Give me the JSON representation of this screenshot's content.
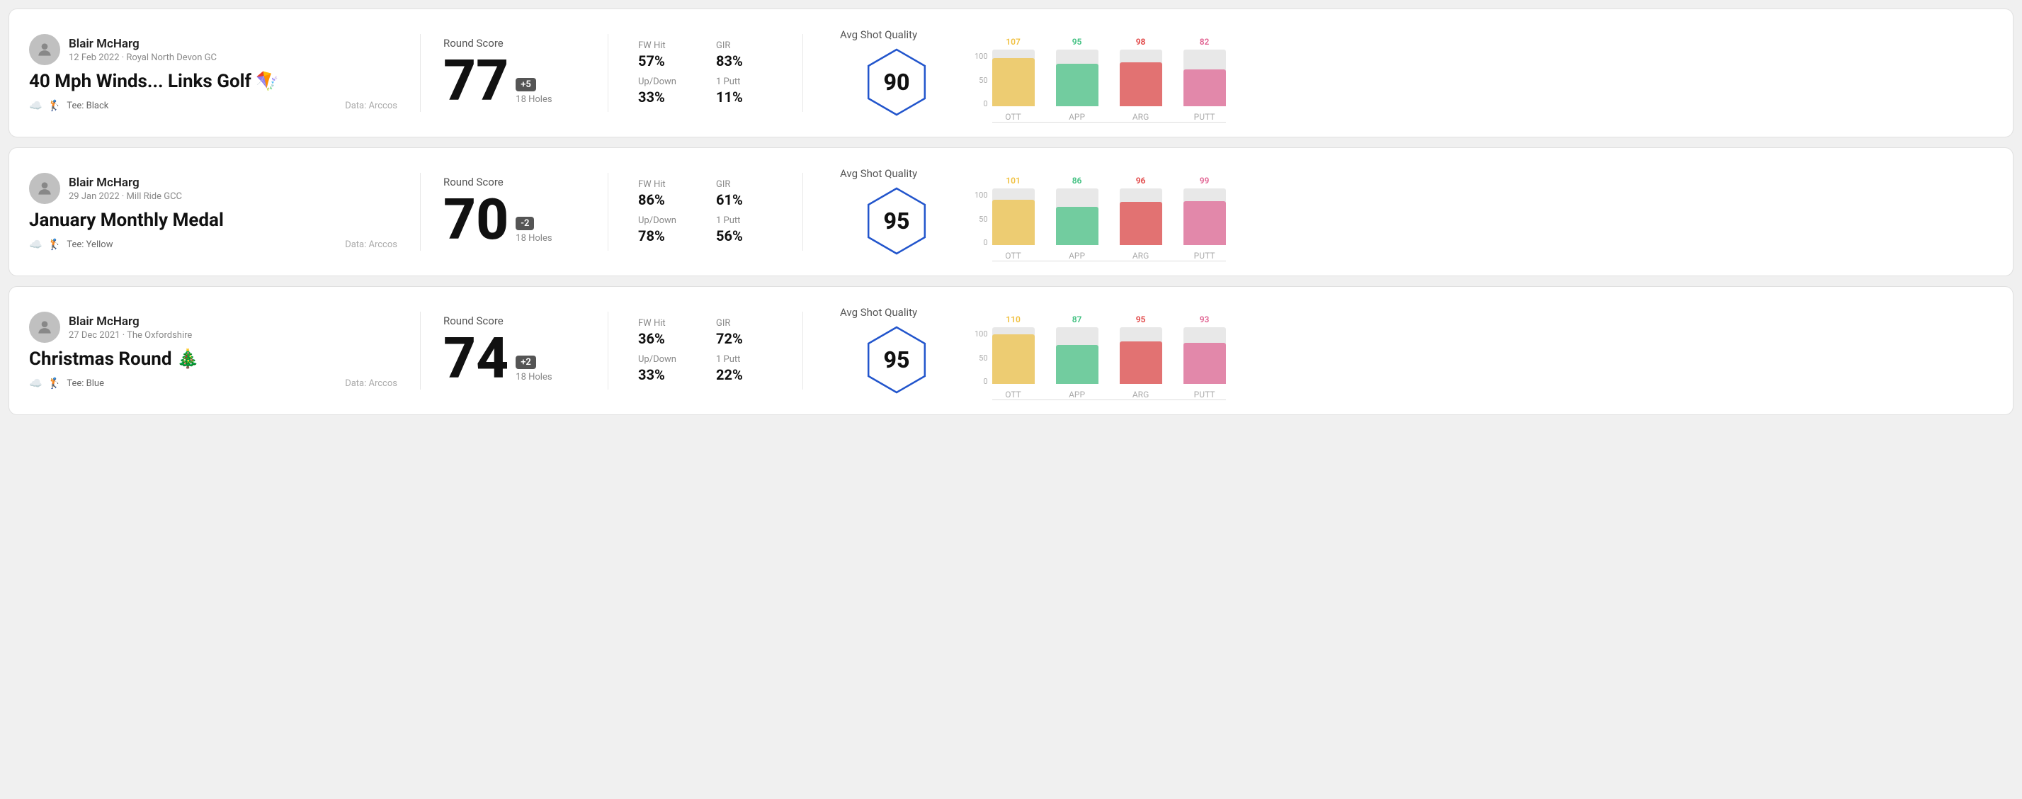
{
  "rounds": [
    {
      "id": "round1",
      "user": {
        "name": "Blair McHarg",
        "date_course": "12 Feb 2022 · Royal North Devon GC"
      },
      "title": "40 Mph Winds... Links Golf 🪁",
      "tee": "Black",
      "data_source": "Data: Arccos",
      "score": "77",
      "score_badge": "+5",
      "holes": "18 Holes",
      "fw_hit": "57%",
      "gir": "83%",
      "up_down": "33%",
      "one_putt": "11%",
      "shot_quality": "90",
      "chart": {
        "ott": {
          "value": 107,
          "color": "#f0c040",
          "pct": 85
        },
        "app": {
          "value": 95,
          "color": "#40c080",
          "pct": 75
        },
        "arg": {
          "value": 98,
          "color": "#e04040",
          "pct": 78
        },
        "putt": {
          "value": 82,
          "color": "#e06090",
          "pct": 65
        }
      }
    },
    {
      "id": "round2",
      "user": {
        "name": "Blair McHarg",
        "date_course": "29 Jan 2022 · Mill Ride GCC"
      },
      "title": "January Monthly Medal",
      "tee": "Yellow",
      "data_source": "Data: Arccos",
      "score": "70",
      "score_badge": "-2",
      "holes": "18 Holes",
      "fw_hit": "86%",
      "gir": "61%",
      "up_down": "78%",
      "one_putt": "56%",
      "shot_quality": "95",
      "chart": {
        "ott": {
          "value": 101,
          "color": "#f0c040",
          "pct": 80
        },
        "app": {
          "value": 86,
          "color": "#40c080",
          "pct": 68
        },
        "arg": {
          "value": 96,
          "color": "#e04040",
          "pct": 76
        },
        "putt": {
          "value": 99,
          "color": "#e06090",
          "pct": 78
        }
      }
    },
    {
      "id": "round3",
      "user": {
        "name": "Blair McHarg",
        "date_course": "27 Dec 2021 · The Oxfordshire"
      },
      "title": "Christmas Round 🎄",
      "tee": "Blue",
      "data_source": "Data: Arccos",
      "score": "74",
      "score_badge": "+2",
      "holes": "18 Holes",
      "fw_hit": "36%",
      "gir": "72%",
      "up_down": "33%",
      "one_putt": "22%",
      "shot_quality": "95",
      "chart": {
        "ott": {
          "value": 110,
          "color": "#f0c040",
          "pct": 87
        },
        "app": {
          "value": 87,
          "color": "#40c080",
          "pct": 69
        },
        "arg": {
          "value": 95,
          "color": "#e04040",
          "pct": 75
        },
        "putt": {
          "value": 93,
          "color": "#e06090",
          "pct": 73
        }
      }
    }
  ],
  "labels": {
    "round_score": "Round Score",
    "fw_hit": "FW Hit",
    "gir": "GIR",
    "up_down": "Up/Down",
    "one_putt": "1 Putt",
    "avg_shot_quality": "Avg Shot Quality",
    "ott": "OTT",
    "app": "APP",
    "arg": "ARG",
    "putt": "PUTT",
    "y100": "100",
    "y50": "50",
    "y0": "0",
    "tee_prefix": "Tee:"
  }
}
